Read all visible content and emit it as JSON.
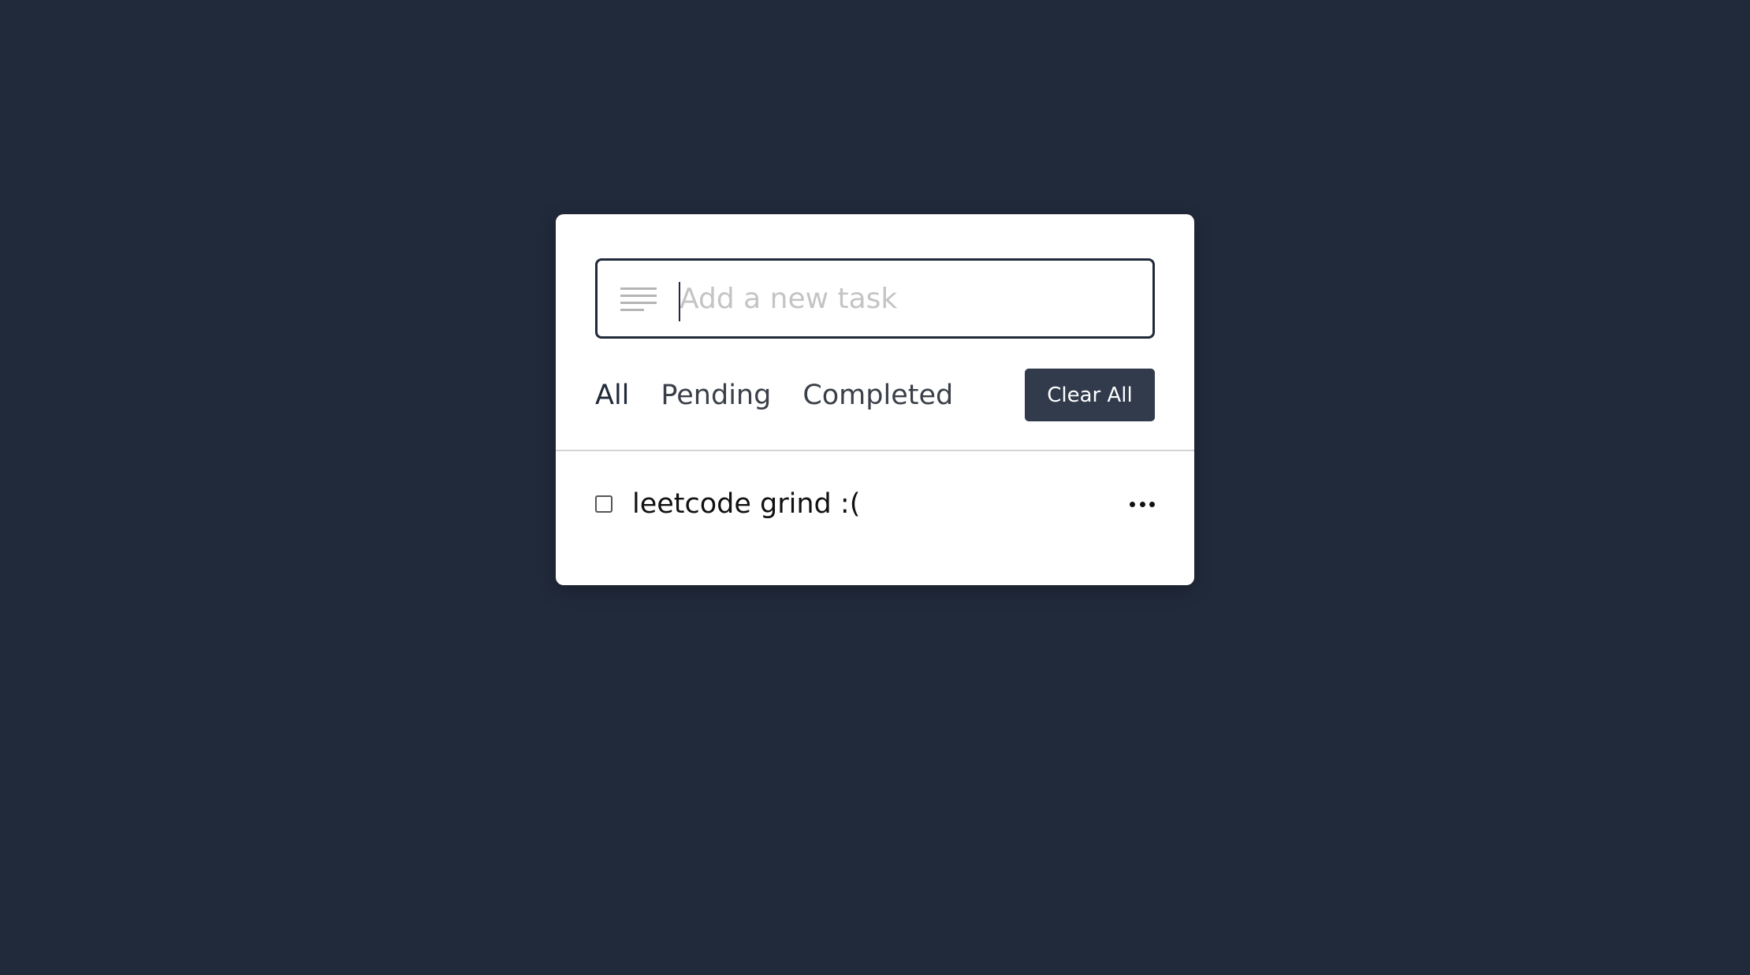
{
  "input": {
    "placeholder": "Add a new task",
    "icon": "list-icon"
  },
  "filters": [
    {
      "label": "All",
      "active": true
    },
    {
      "label": "Pending",
      "active": false
    },
    {
      "label": "Completed",
      "active": false
    }
  ],
  "clear_button": {
    "label": "Clear All"
  },
  "tasks": [
    {
      "label": "leetcode grind :(",
      "completed": false,
      "menu_icon": "more-icon"
    }
  ],
  "colors": {
    "background": "#212a3b",
    "card": "#ffffff",
    "button": "#323b4c",
    "placeholder": "#c4c4c4"
  }
}
